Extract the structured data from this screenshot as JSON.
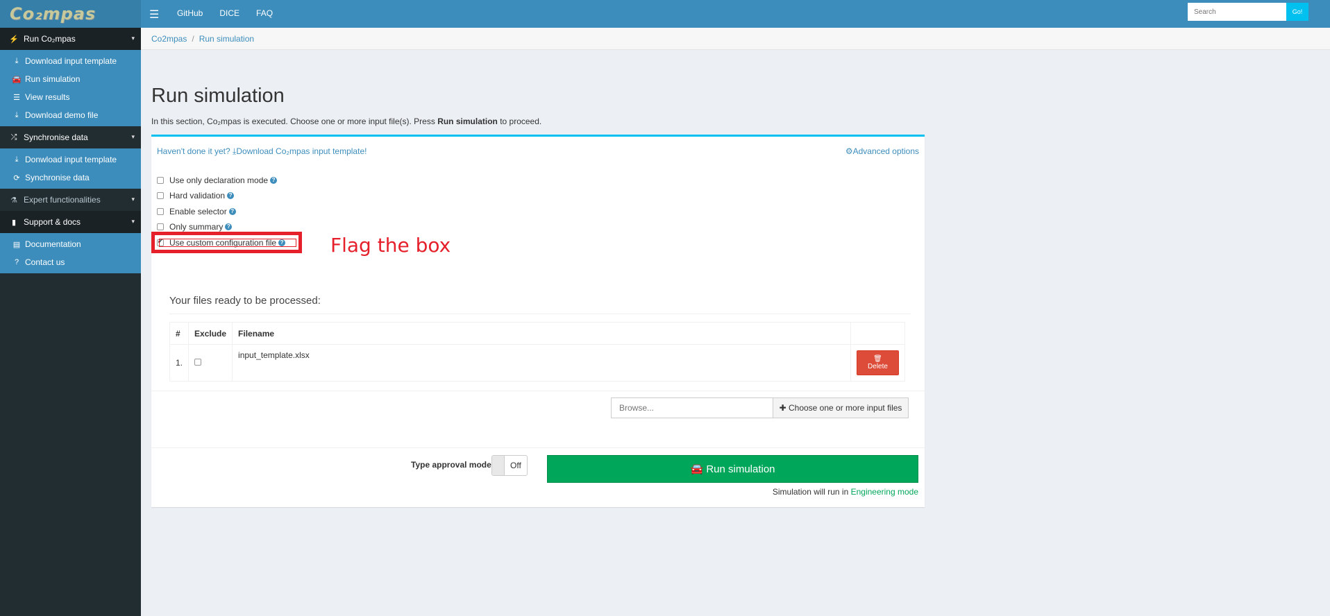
{
  "brand": {
    "logo_text": "Co₂mpas"
  },
  "topnav": {
    "menu_icon": "hamburger-icon",
    "links": [
      "GitHub",
      "DICE",
      "FAQ"
    ],
    "search_placeholder": "Search",
    "search_button": "Go!"
  },
  "sidebar": {
    "sections": [
      {
        "label": "Run Co₂mpas",
        "icon": "bolt-icon",
        "items": [
          {
            "label": "Download input template",
            "icon": "download-icon"
          },
          {
            "label": "Run simulation",
            "icon": "car-icon"
          },
          {
            "label": "View results",
            "icon": "list-icon"
          },
          {
            "label": "Download demo file",
            "icon": "download-icon"
          }
        ]
      },
      {
        "label": "Synchronise data",
        "icon": "shuffle-icon",
        "items": [
          {
            "label": "Donwload input template",
            "icon": "download-icon"
          },
          {
            "label": "Synchronise data",
            "icon": "refresh-icon"
          }
        ]
      },
      {
        "label": "Expert functionalities",
        "icon": "flask-icon",
        "items": []
      },
      {
        "label": "Support & docs",
        "icon": "bookmark-icon",
        "items": [
          {
            "label": "Documentation",
            "icon": "book-icon"
          },
          {
            "label": "Contact us",
            "icon": "question-circle-icon"
          }
        ]
      }
    ]
  },
  "breadcrumb": [
    "Co2mpas",
    "Run simulation"
  ],
  "page": {
    "title": "Run simulation",
    "intro_before": "In this section, Co₂mpas is executed. Choose one or more input file(s). Press ",
    "intro_bold": "Run simulation",
    "intro_after": " to proceed."
  },
  "box": {
    "template_prompt": "Haven't done it yet?",
    "template_link": "Download Co₂mpas input template!",
    "advanced_options": "Advanced options",
    "options": [
      {
        "label": "Use only declaration mode",
        "checked": false
      },
      {
        "label": "Hard validation",
        "checked": false
      },
      {
        "label": "Enable selector",
        "checked": false
      },
      {
        "label": "Only summary",
        "checked": false
      },
      {
        "label": "Use custom configuration file",
        "checked": true
      }
    ],
    "annotation": "Flag the box",
    "files_title": "Your files ready to be processed:",
    "table": {
      "headers": [
        "#",
        "Exclude",
        "Filename",
        ""
      ],
      "rows": [
        {
          "index": "1.",
          "filename": "input_template.xlsx",
          "action": "Delete"
        }
      ]
    },
    "browse_placeholder": "Browse...",
    "choose_button": "Choose one or more input files",
    "type_approval_label": "Type approval mode",
    "type_approval_state": "Off",
    "run_button": "Run simulation",
    "run_note_prefix": "Simulation will run in ",
    "run_note_mode": "Engineering mode"
  },
  "colors": {
    "header": "#3c8dbc",
    "sidebar": "#222d32",
    "accent": "#00c0ef",
    "success": "#00a65a",
    "danger": "#dd4b39",
    "annotation": "#e6202b"
  }
}
